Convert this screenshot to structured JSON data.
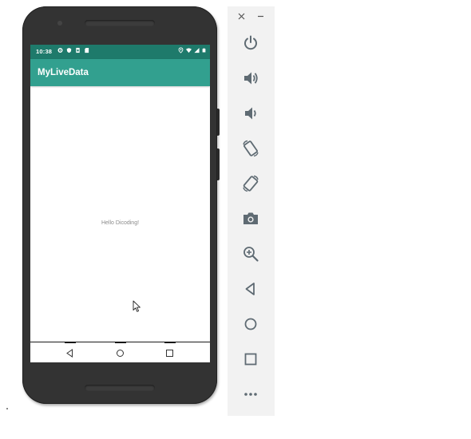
{
  "status_bar": {
    "time": "10:38",
    "icons_left": [
      "gear-icon",
      "shield-icon",
      "sim-icon",
      "sd-card-icon"
    ],
    "icons_right": [
      "location-icon",
      "wifi-icon",
      "signal-icon",
      "battery-icon"
    ]
  },
  "app_bar": {
    "title": "MyLiveData",
    "color": "#32a08f",
    "status_color": "#1e7a6b"
  },
  "content": {
    "text": "Hello Dicoding!"
  },
  "nav_bar": {
    "buttons": [
      "back-icon",
      "home-icon",
      "recents-icon"
    ]
  },
  "emulator_toolbar": {
    "window_controls": [
      "close-icon",
      "minimize-icon"
    ],
    "buttons": [
      "power-icon",
      "volume-up-icon",
      "volume-down-icon",
      "rotate-left-icon",
      "rotate-right-icon",
      "camera-icon",
      "zoom-icon",
      "back-icon",
      "home-icon",
      "overview-icon",
      "more-icon"
    ]
  }
}
